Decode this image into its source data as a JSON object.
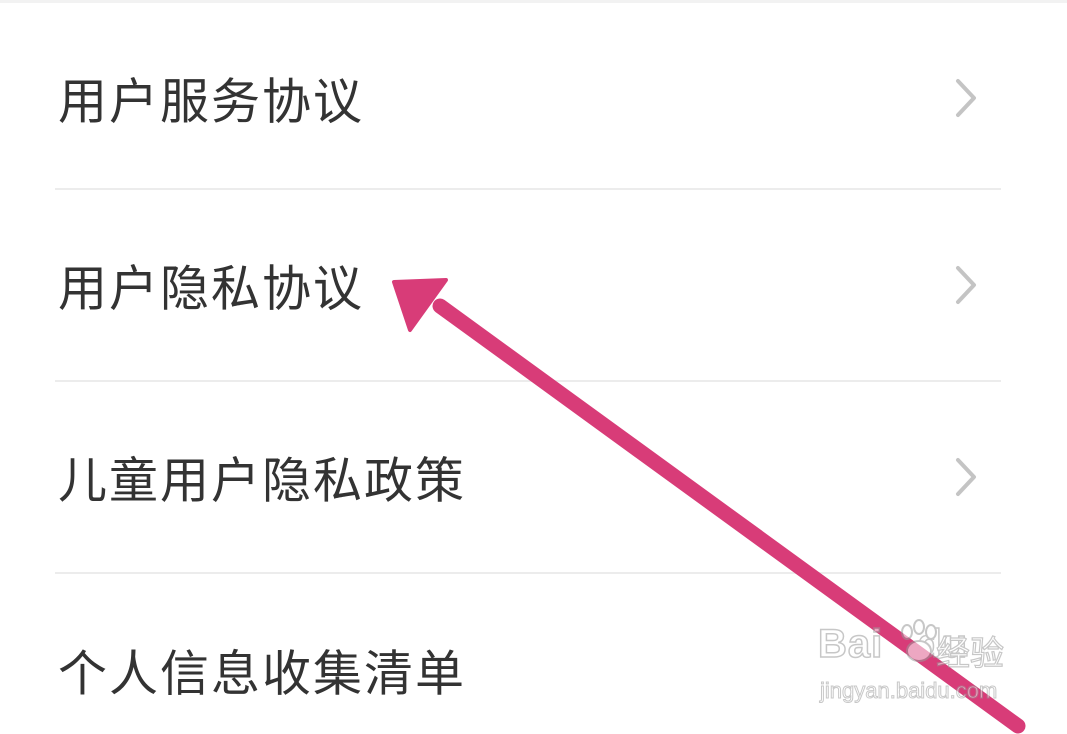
{
  "menu": {
    "items": [
      {
        "label": "用户服务协议"
      },
      {
        "label": "用户隐私协议"
      },
      {
        "label": "儿童用户隐私政策"
      },
      {
        "label": "个人信息收集清单"
      }
    ]
  },
  "colors": {
    "text": "#333333",
    "chevron": "#c4c4c4",
    "divider": "#ececec",
    "annotation_arrow": "#d83c78"
  },
  "icons": {
    "row_chevron": "chevron-right-icon",
    "annotation": "arrow-annotation"
  },
  "watermark": {
    "brand": "Bai",
    "brand_suffix": "du",
    "product": "经验",
    "url": "jingyan.baidu.com"
  }
}
